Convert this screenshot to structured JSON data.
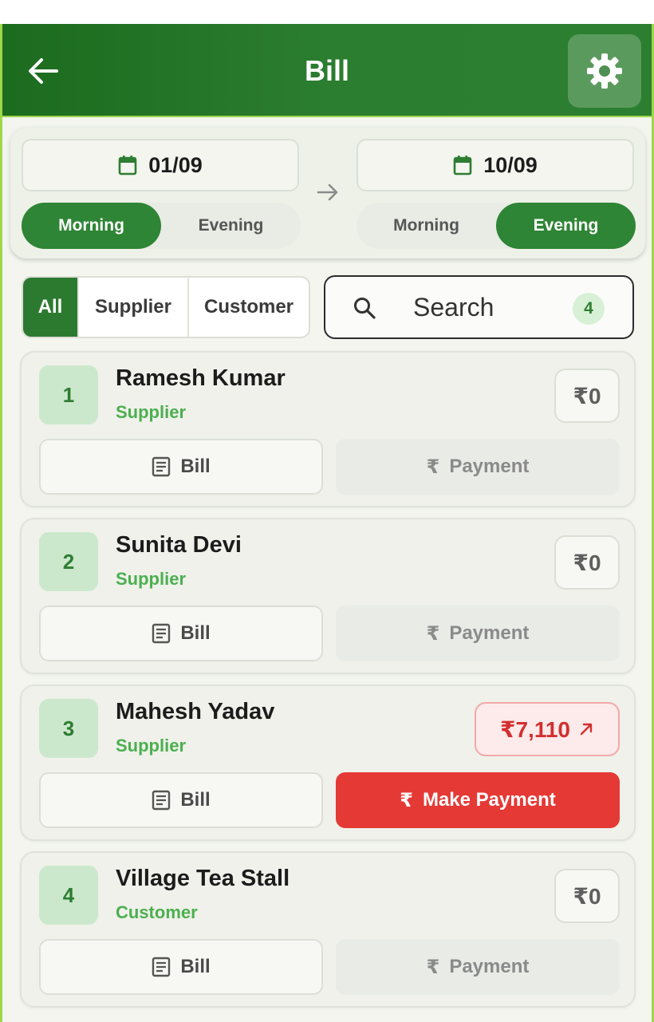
{
  "header": {
    "title": "Bill",
    "back_icon": "arrow-left-icon",
    "settings_icon": "gear-icon"
  },
  "date_range": {
    "from": {
      "date": "01/09",
      "shifts": [
        "Morning",
        "Evening"
      ],
      "selected": "Morning"
    },
    "to": {
      "date": "10/09",
      "shifts": [
        "Morning",
        "Evening"
      ],
      "selected": "Evening"
    }
  },
  "filters": {
    "options": [
      "All",
      "Supplier",
      "Customer"
    ],
    "selected": "All"
  },
  "search": {
    "placeholder": "Search",
    "count": "4"
  },
  "labels": {
    "bill": "Bill",
    "payment": "Payment",
    "make_payment": "Make Payment"
  },
  "colors": {
    "primary": "#2e7d32",
    "accent": "#9ed74a",
    "danger": "#e53935",
    "supplier_text": "#4caf50"
  },
  "entries": [
    {
      "index": "1",
      "name": "Ramesh Kumar",
      "role": "Supplier",
      "amount": "₹0",
      "payment_label": "Payment",
      "payment_enabled": false
    },
    {
      "index": "2",
      "name": "Sunita Devi",
      "role": "Supplier",
      "amount": "₹0",
      "payment_label": "Payment",
      "payment_enabled": false
    },
    {
      "index": "3",
      "name": "Mahesh Yadav",
      "role": "Supplier",
      "amount": "₹7,110",
      "payment_label": "Make Payment",
      "payment_enabled": true
    },
    {
      "index": "4",
      "name": "Village Tea Stall",
      "role": "Customer",
      "amount": "₹0",
      "payment_label": "Payment",
      "payment_enabled": false
    }
  ]
}
